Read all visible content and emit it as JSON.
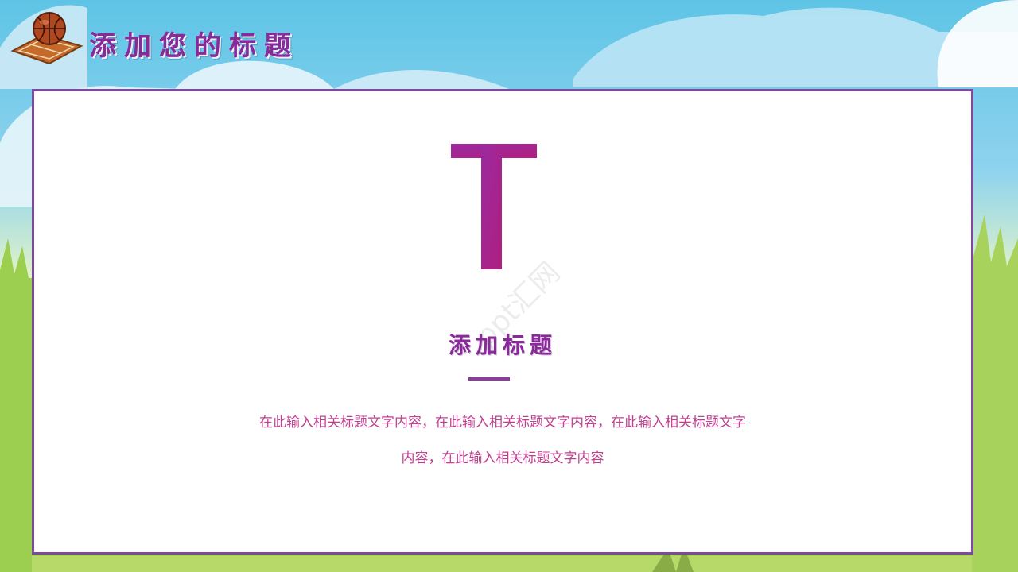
{
  "slide": {
    "title": "添加您的标题",
    "big_letter": "T",
    "subtitle": "添加标题",
    "body_line1": "在此输入相关标题文字内容，在此输入相关标题文字内容，在此输入相关标题文字",
    "body_line2": "内容，在此输入相关标题文字内容",
    "watermark": "ppt汇网"
  },
  "icons": {
    "logo": "basketball-court-icon"
  },
  "colors": {
    "accent_purple": "#8a2a9a",
    "border_purple": "#7b4a9c",
    "body_pink": "#c0408f",
    "sky": "#5ec4e6",
    "grass": "#a8d25a"
  }
}
